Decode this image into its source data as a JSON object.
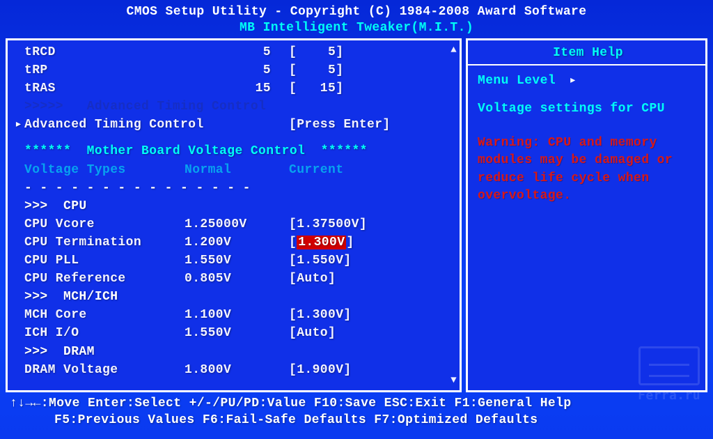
{
  "header": {
    "title1": "CMOS Setup Utility - Copyright (C) 1984-2008 Award Software",
    "title2": "MB Intelligent Tweaker(M.I.T.)"
  },
  "rows": {
    "trcd": {
      "label": "tRCD",
      "normal": "5",
      "current": "[    5]"
    },
    "trp": {
      "label": "tRP",
      "normal": "5",
      "current": "[    5]"
    },
    "tras": {
      "label": "tRAS",
      "normal": "15",
      "current": "[   15]"
    },
    "adv_dim": {
      "label": ">>>>>   Advanced Timing Control"
    },
    "adv": {
      "label": "Advanced Timing Control",
      "current": "[Press Enter]"
    },
    "mb_sec": "******  Mother Board Voltage Control  ******",
    "vhead": {
      "label": "Voltage Types",
      "normal": "Normal",
      "current": "Current"
    },
    "dash": "- - - - - - - - - - - - - - -",
    "cpu_sec": ">>>  CPU",
    "vcore": {
      "label": "CPU Vcore",
      "normal": "1.25000V",
      "current": "[1.37500V]"
    },
    "cterm": {
      "label": "CPU Termination",
      "normal": "1.200V",
      "current_pre": "[",
      "current_sel": "1.300V",
      "current_post": "]"
    },
    "cpll": {
      "label": "CPU PLL",
      "normal": "1.550V",
      "current": "[1.550V]"
    },
    "cref": {
      "label": "CPU Reference",
      "normal": "0.805V",
      "current": "[Auto]"
    },
    "mch_sec": ">>>  MCH/ICH",
    "mchc": {
      "label": "MCH Core",
      "normal": "1.100V",
      "current": "[1.300V]"
    },
    "ichio": {
      "label": "ICH I/O",
      "normal": "1.550V",
      "current": "[Auto]"
    },
    "dram_sec": ">>>  DRAM",
    "dramv": {
      "label": "DRAM Voltage",
      "normal": "1.800V",
      "current": "[1.900V]"
    }
  },
  "help": {
    "title": "Item Help",
    "menu_level": "Menu Level",
    "text": "Voltage settings for CPU",
    "warning": "Warning: CPU and memory modules may be damaged or reduce life cycle when overvoltage."
  },
  "footer": {
    "line1": "↑↓→←:Move   Enter:Select   +/-/PU/PD:Value   F10:Save   ESC:Exit   F1:General Help",
    "line2": "F5:Previous Values   F6:Fail-Safe Defaults   F7:Optimized Defaults"
  },
  "watermark": "Ferra.ru"
}
